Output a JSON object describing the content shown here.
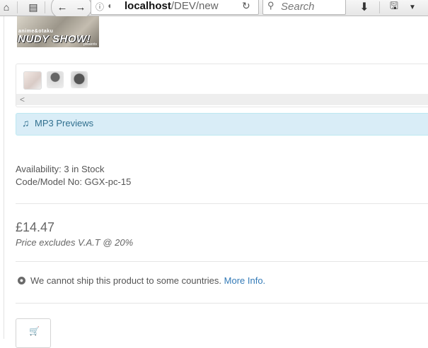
{
  "browser": {
    "url_host": "localhost",
    "url_path": "/DEV/new",
    "search_placeholder": "Search",
    "icons": [
      "home-icon",
      "reader-icon",
      "back-icon",
      "forward-icon",
      "info-icon",
      "shield-icon",
      "reload-icon",
      "search-icon",
      "download-icon",
      "save-icon",
      "menu-arrow-icon"
    ]
  },
  "logo": {
    "small_text": "anime&otaku",
    "main_text": "NUDY SHOW!",
    "tag": "presents"
  },
  "gallery": {
    "thumbnails": [
      "thumb-1",
      "thumb-2",
      "thumb-3"
    ],
    "scroll_left": "<"
  },
  "mp3": {
    "label": "MP3 Previews",
    "icon": "music-note-icon"
  },
  "product": {
    "availability": "Availability: 3 in Stock",
    "code": "Code/Model No: GGX-pc-15",
    "price": "£14.47",
    "vat_note": "Price excludes V.A.T @ 20%",
    "ship_text": "We cannot ship this product to some countries.",
    "ship_link": "More Info."
  },
  "colors": {
    "info_bg": "#d9edf7",
    "info_text": "#31708f",
    "link": "#337ab7"
  }
}
